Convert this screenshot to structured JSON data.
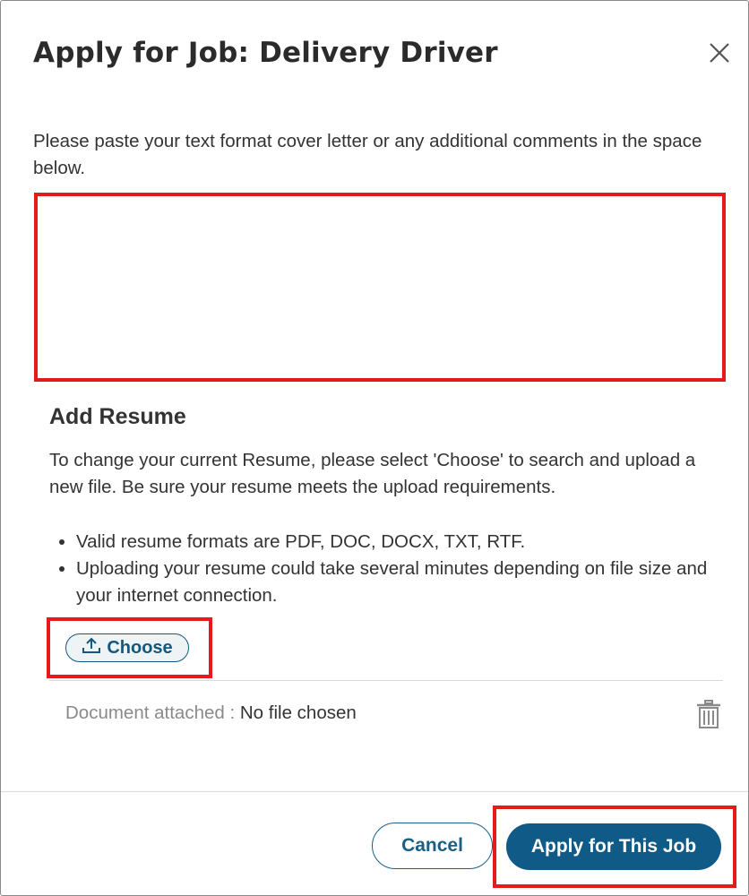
{
  "dialog": {
    "title": "Apply for Job: Delivery Driver",
    "close_icon": "close-icon"
  },
  "cover_letter": {
    "instructions": "Please paste your text format cover letter or any additional comments in the space below.",
    "value": ""
  },
  "resume": {
    "heading": "Add Resume",
    "description": "To change your current Resume, please select 'Choose' to search and upload a new file. Be sure your resume meets the upload requirements.",
    "requirements": [
      "Valid resume formats are PDF, DOC, DOCX, TXT, RTF.",
      "Uploading your resume could take several minutes depending on file size and your internet connection."
    ],
    "choose_label": "Choose",
    "choose_icon": "upload-icon",
    "attached_label": "Document attached :",
    "attached_value": "No file chosen",
    "delete_icon": "trash-icon"
  },
  "footer": {
    "cancel_label": "Cancel",
    "apply_label": "Apply for This Job"
  },
  "colors": {
    "primary": "#0f5a87",
    "highlight": "#e31b1b",
    "muted_text": "#8a8a8a"
  }
}
